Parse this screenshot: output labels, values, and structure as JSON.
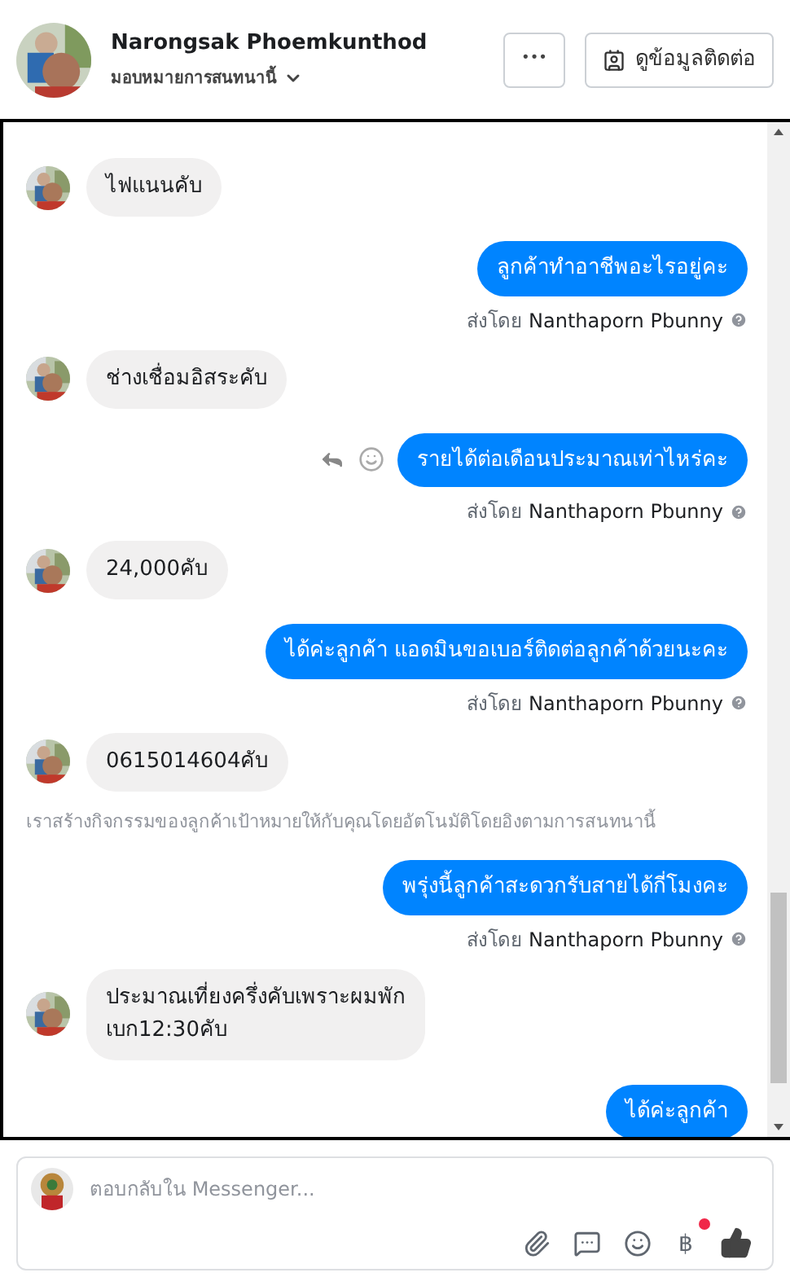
{
  "header": {
    "name": "Narongsak Phoemkunthod",
    "assign_label": "มอบหมายการสนทนานี้",
    "more_button": "•••",
    "contact_button": "ดูข้อมูลติดต่อ"
  },
  "messages": [
    {
      "kind": "incoming",
      "text": "ไฟแนนคับ"
    },
    {
      "kind": "outgoing",
      "text": "ลูกค้าทำอาชีพอะไรอยู่คะ",
      "sent_by": "ส่งโดย",
      "sender": "Nanthaporn Pbunny",
      "show_actions": false
    },
    {
      "kind": "incoming",
      "text": "ช่างเชื่อมอิสระคับ"
    },
    {
      "kind": "outgoing",
      "text": "รายได้ต่อเดือนประมาณเท่าไหร่คะ",
      "sent_by": "ส่งโดย",
      "sender": "Nanthaporn Pbunny",
      "show_actions": true
    },
    {
      "kind": "incoming",
      "text": "24,000คับ"
    },
    {
      "kind": "outgoing",
      "text": "ได้ค่ะลูกค้า แอดมินขอเบอร์ติดต่อลูกค้าด้วยนะคะ",
      "sent_by": "ส่งโดย",
      "sender": "Nanthaporn Pbunny",
      "show_actions": false
    },
    {
      "kind": "incoming",
      "text": "0615014604คับ"
    },
    {
      "kind": "notice",
      "text": "เราสร้างกิจกรรมของลูกค้าเป้าหมายให้กับคุณโดยอัตโนมัติโดยอิงตามการสนทนานี้"
    },
    {
      "kind": "outgoing",
      "text": "พรุ่งนี้ลูกค้าสะดวกรับสายได้กี่โมงคะ",
      "sent_by": "ส่งโดย",
      "sender": "Nanthaporn Pbunny",
      "show_actions": false
    },
    {
      "kind": "incoming",
      "text": "ประมาณเที่ยงครึ่งคับเพราะผมพัก\nเบก12:30คับ"
    },
    {
      "kind": "outgoing",
      "text": "ได้ค่ะลูกค้า"
    }
  ],
  "composer": {
    "placeholder": "ตอบกลับใน Messenger...",
    "currency_symbol": "฿",
    "currency_dot": true
  }
}
